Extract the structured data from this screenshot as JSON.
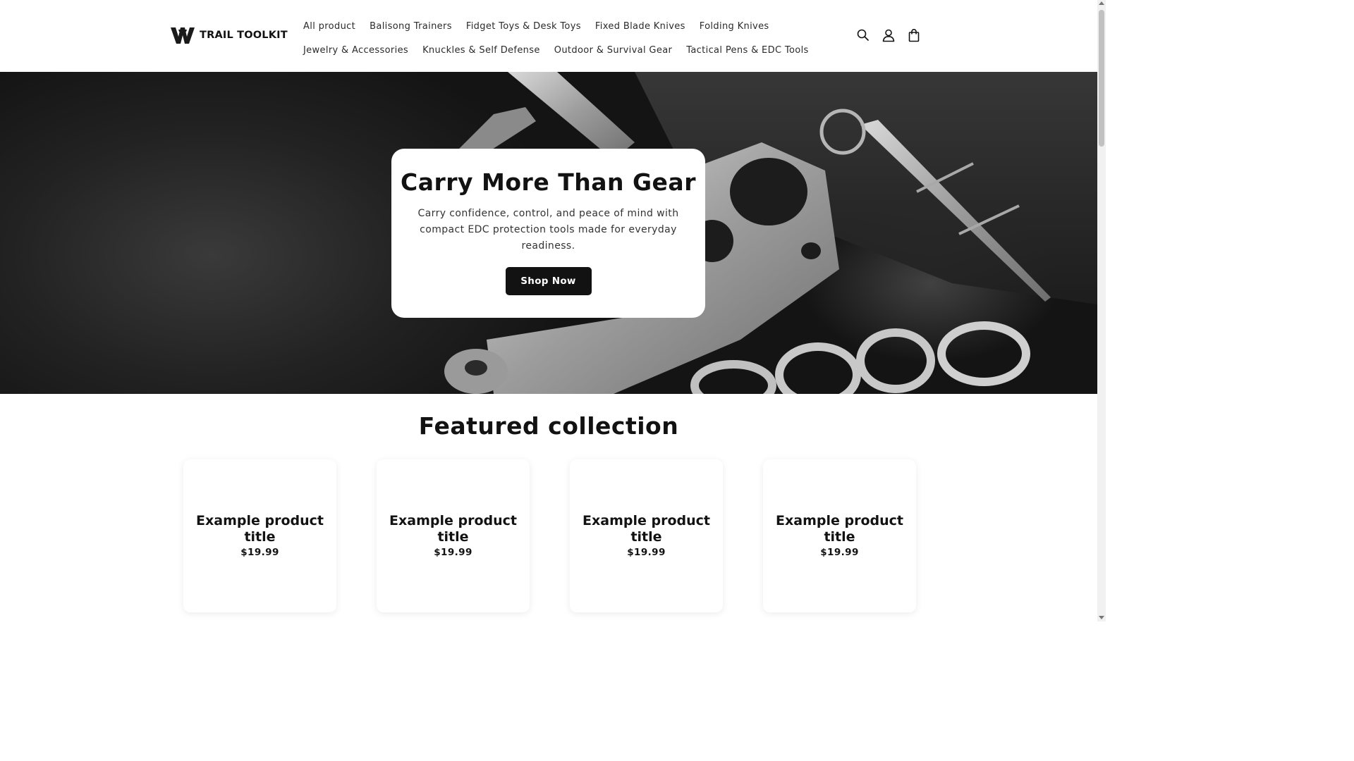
{
  "brand": {
    "name": "TRAIL TOOLKIT",
    "logo_icon": "tt-shield-logo"
  },
  "nav": {
    "row1": [
      "All product",
      "Balisong Trainers",
      "Fidget Toys & Desk Toys",
      "Fixed Blade Knives",
      "Folding Knives"
    ],
    "row2": [
      "Jewelry & Accessories",
      "Knuckles & Self Defense",
      "Outdoor & Survival Gear",
      "Tactical Pens & EDC Tools"
    ]
  },
  "header_icons": [
    "search-icon",
    "account-icon",
    "cart-icon"
  ],
  "hero": {
    "title": "Carry More Than Gear",
    "text": "Carry confidence, control, and peace of mind with compact EDC protection tools made for everyday readiness.",
    "button": "Shop Now"
  },
  "featured": {
    "title": "Featured collection",
    "products": [
      {
        "title": "Example product title",
        "price": "$19.99"
      },
      {
        "title": "Example product title",
        "price": "$19.99"
      },
      {
        "title": "Example product title",
        "price": "$19.99"
      },
      {
        "title": "Example product title",
        "price": "$19.99"
      }
    ]
  },
  "colors": {
    "text": "#121212",
    "button_bg": "#121212",
    "button_text": "#ffffff",
    "page_bg": "#ffffff"
  }
}
